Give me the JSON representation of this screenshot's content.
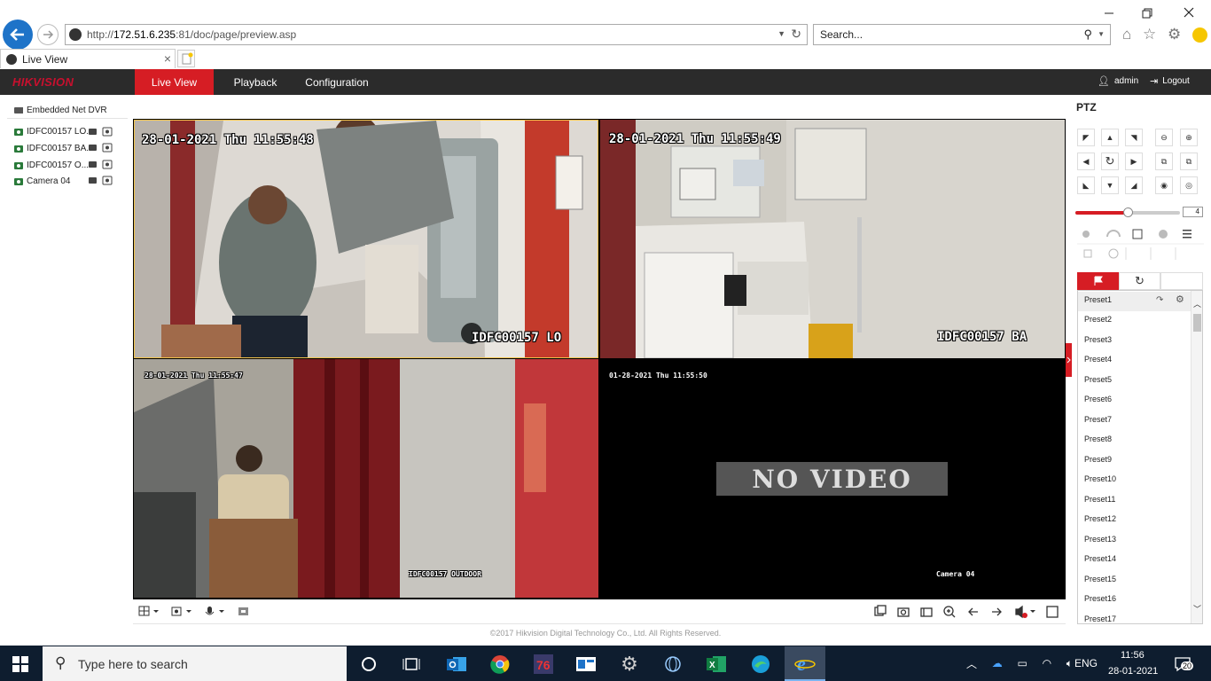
{
  "browser": {
    "url_scheme": "http://",
    "url_host": "172.51.6.235",
    "url_path": ":81/doc/page/preview.asp",
    "search_placeholder": "Search...",
    "tab_title": "Live View"
  },
  "app": {
    "logo": "HIKVISION",
    "nav": [
      "Live View",
      "Playback",
      "Configuration"
    ],
    "user": "admin",
    "logout": "Logout",
    "footer": "©2017 Hikvision Digital Technology Co., Ltd. All Rights Reserved."
  },
  "device_tree": {
    "root": "Embedded Net DVR",
    "cameras": [
      "IDFC00157 LO...",
      "IDFC00157 BA...",
      "IDFC00157 O...",
      "Camera 04"
    ]
  },
  "video": {
    "cells": [
      {
        "timestamp": "28-01-2021 Thu 11:55:48",
        "name": "IDFC00157 LO"
      },
      {
        "timestamp": "28-01-2021 Thu 11:55:49",
        "name": "IDFC00157 BA"
      },
      {
        "timestamp": "28-01-2021 Thu 11:55:47",
        "name": "IDFC00157 OUTDOOR"
      },
      {
        "timestamp": "01-28-2021 Thu 11:55:50",
        "name": "Camera 04",
        "no_video": "NO VIDEO"
      }
    ]
  },
  "ptz": {
    "title": "PTZ",
    "speed": "4",
    "speed_fraction": 0.5,
    "presets": [
      "Preset1",
      "Preset2",
      "Preset3",
      "Preset4",
      "Preset5",
      "Preset6",
      "Preset7",
      "Preset8",
      "Preset9",
      "Preset10",
      "Preset11",
      "Preset12",
      "Preset13",
      "Preset14",
      "Preset15",
      "Preset16",
      "Preset17"
    ]
  },
  "taskbar": {
    "search_placeholder": "Type here to search",
    "language": "ENG",
    "time": "11:56",
    "date": "28-01-2021",
    "notifications": "20"
  },
  "colors": {
    "accent": "#d61d24",
    "appbar": "#2b2b2b",
    "taskbar": "#0e1d2f",
    "selected_border": "#f0c24a"
  }
}
